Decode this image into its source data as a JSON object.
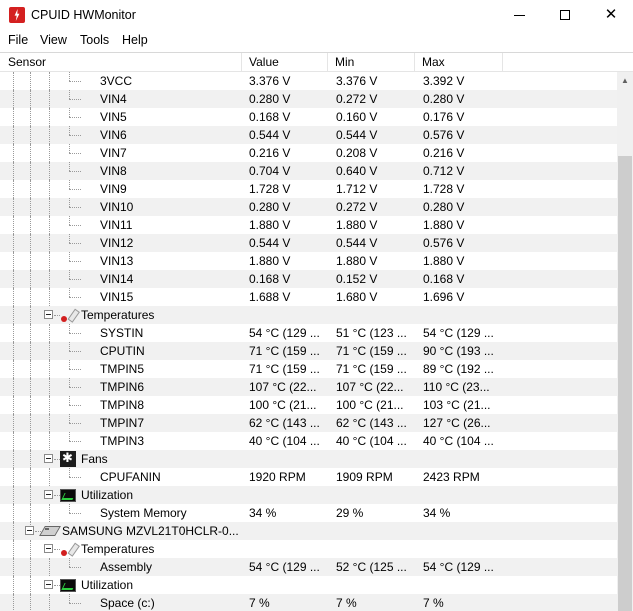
{
  "window": {
    "title": "CPUID HWMonitor",
    "close_glyph": "✕"
  },
  "menu": {
    "file": "File",
    "view": "View",
    "tools": "Tools",
    "help": "Help"
  },
  "columns": {
    "sensor": "Sensor",
    "value": "Value",
    "min": "Min",
    "max": "Max"
  },
  "voltages": [
    {
      "label": "3VCC",
      "value": "3.376 V",
      "min": "3.376 V",
      "max": "3.392 V"
    },
    {
      "label": "VIN4",
      "value": "0.280 V",
      "min": "0.272 V",
      "max": "0.280 V"
    },
    {
      "label": "VIN5",
      "value": "0.168 V",
      "min": "0.160 V",
      "max": "0.176 V"
    },
    {
      "label": "VIN6",
      "value": "0.544 V",
      "min": "0.544 V",
      "max": "0.576 V"
    },
    {
      "label": "VIN7",
      "value": "0.216 V",
      "min": "0.208 V",
      "max": "0.216 V"
    },
    {
      "label": "VIN8",
      "value": "0.704 V",
      "min": "0.640 V",
      "max": "0.712 V"
    },
    {
      "label": "VIN9",
      "value": "1.728 V",
      "min": "1.712 V",
      "max": "1.728 V"
    },
    {
      "label": "VIN10",
      "value": "0.280 V",
      "min": "0.272 V",
      "max": "0.280 V"
    },
    {
      "label": "VIN11",
      "value": "1.880 V",
      "min": "1.880 V",
      "max": "1.880 V"
    },
    {
      "label": "VIN12",
      "value": "0.544 V",
      "min": "0.544 V",
      "max": "0.576 V"
    },
    {
      "label": "VIN13",
      "value": "1.880 V",
      "min": "1.880 V",
      "max": "1.880 V"
    },
    {
      "label": "VIN14",
      "value": "0.168 V",
      "min": "0.152 V",
      "max": "0.168 V"
    },
    {
      "label": "VIN15",
      "value": "1.688 V",
      "min": "1.680 V",
      "max": "1.696 V"
    }
  ],
  "temperatures": {
    "label": "Temperatures",
    "items": [
      {
        "label": "SYSTIN",
        "value": "54 °C  (129 ...",
        "min": "51 °C  (123 ...",
        "max": "54 °C  (129 ..."
      },
      {
        "label": "CPUTIN",
        "value": "71 °C  (159 ...",
        "min": "71 °C  (159 ...",
        "max": "90 °C  (193 ..."
      },
      {
        "label": "TMPIN5",
        "value": "71 °C  (159 ...",
        "min": "71 °C  (159 ...",
        "max": "89 °C  (192 ..."
      },
      {
        "label": "TMPIN6",
        "value": "107 °C  (22...",
        "min": "107 °C  (22...",
        "max": "110 °C  (23..."
      },
      {
        "label": "TMPIN8",
        "value": "100 °C  (21...",
        "min": "100 °C  (21...",
        "max": "103 °C  (21..."
      },
      {
        "label": "TMPIN7",
        "value": "62 °C  (143 ...",
        "min": "62 °C  (143 ...",
        "max": "127 °C  (26..."
      },
      {
        "label": "TMPIN3",
        "value": "40 °C  (104 ...",
        "min": "40 °C  (104 ...",
        "max": "40 °C  (104 ..."
      }
    ]
  },
  "fans": {
    "label": "Fans",
    "items": [
      {
        "label": "CPUFANIN",
        "value": "1920 RPM",
        "min": "1909 RPM",
        "max": "2423 RPM"
      }
    ]
  },
  "utilization": {
    "label": "Utilization",
    "items": [
      {
        "label": "System Memory",
        "value": "34 %",
        "min": "29 %",
        "max": "34 %"
      }
    ]
  },
  "disk": {
    "label": "SAMSUNG MZVL21T0HCLR-0...",
    "temperatures": {
      "label": "Temperatures",
      "items": [
        {
          "label": "Assembly",
          "value": "54 °C  (129 ...",
          "min": "52 °C  (125 ...",
          "max": "54 °C  (129 ..."
        }
      ]
    },
    "utilization": {
      "label": "Utilization",
      "items": [
        {
          "label": "Space (c:)",
          "value": "7 %",
          "min": "7 %",
          "max": "7 %"
        }
      ]
    }
  },
  "icons": {
    "app": "hwmonitor-bolt-icon",
    "temperature": "thermometer-icon",
    "fan": "fan-icon",
    "utilization": "utilization-graph-icon",
    "disk": "disk-drive-icon"
  },
  "colors": {
    "row_stripe": "#f1f1f1",
    "thermometer": "#d21f1f",
    "graph": "#2ecc40"
  }
}
